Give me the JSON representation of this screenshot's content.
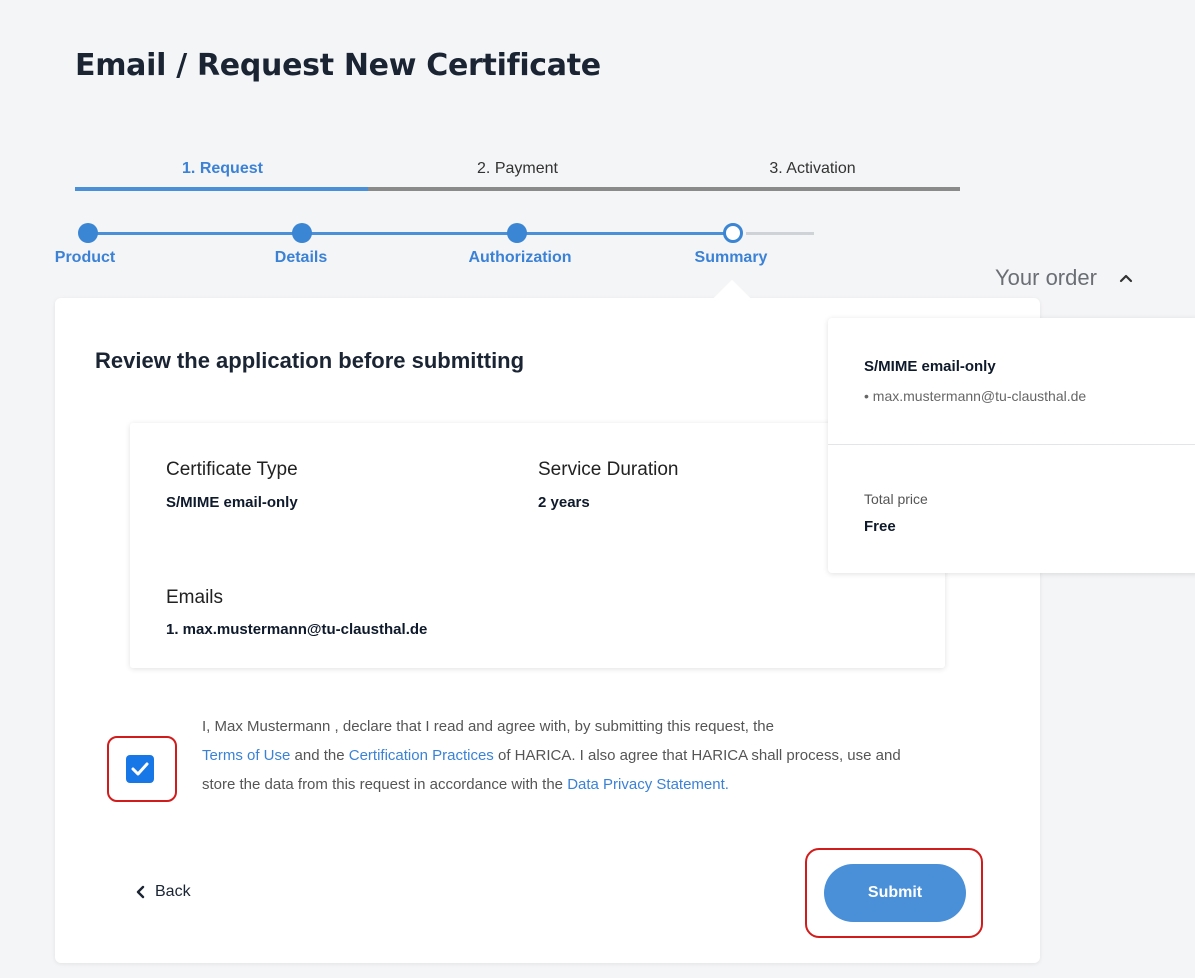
{
  "page": {
    "title": "Email / Request New Certificate"
  },
  "steps_top": [
    {
      "label": "1. Request",
      "active": true
    },
    {
      "label": "2. Payment",
      "active": false
    },
    {
      "label": "3. Activation",
      "active": false
    }
  ],
  "substeps": [
    {
      "label": "Product",
      "state": "done"
    },
    {
      "label": "Details",
      "state": "done"
    },
    {
      "label": "Authorization",
      "state": "done"
    },
    {
      "label": "Summary",
      "state": "current"
    }
  ],
  "review": {
    "title": "Review the application before submitting",
    "cert_type_label": "Certificate Type",
    "cert_type_value": "S/MIME email-only",
    "duration_label": "Service Duration",
    "duration_value": "2 years",
    "emails_label": "Emails",
    "emails_value": "1. max.mustermann@tu-clausthal.de"
  },
  "agreement": {
    "checked": true,
    "text_1": "I, Max Mustermann , declare that I read and agree with, by submitting this request, the",
    "link_terms": "Terms of Use",
    "text_2": " and the ",
    "link_practices": "Certification Practices",
    "text_3": " of HARICA. I also agree that HARICA shall process, use and store the data from this request in accordance with the ",
    "link_privacy": "Data Privacy Statement."
  },
  "actions": {
    "back_label": "Back",
    "submit_label": "Submit"
  },
  "order": {
    "header": "Your order",
    "product": "S/MIME email-only",
    "email": "• max.mustermann@tu-clausthal.de",
    "price_label": "Total price",
    "price_value": "Free"
  },
  "colors": {
    "accent": "#4a90d9",
    "link": "#3b82d6",
    "highlight": "#d21c1c"
  }
}
